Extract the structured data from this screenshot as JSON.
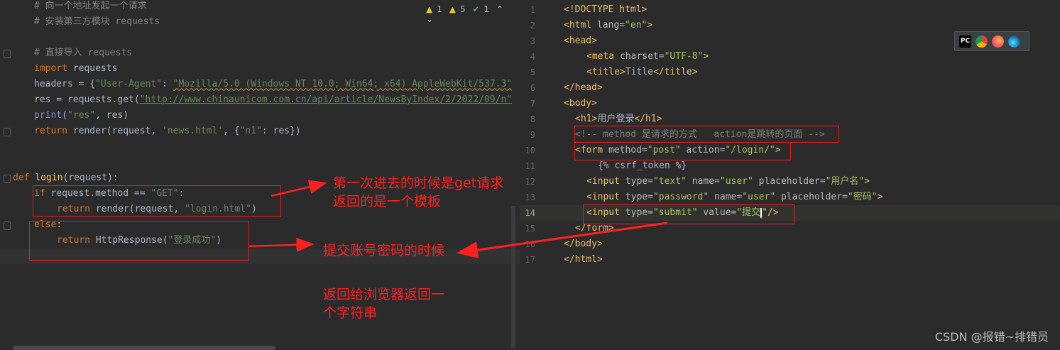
{
  "left_editor": {
    "inspections": {
      "warnings": "1",
      "weak_warnings": "5",
      "ok": "1"
    },
    "lines": {
      "l1": "# 向一个地址发起一个请求",
      "l2": "# 安装第三方模块 requests",
      "l4": "# 直接导入 requests",
      "l5_kw": "import",
      "l5_rest": " requests",
      "l6_a": "headers = {",
      "l6_key": "\"User-Agent\"",
      "l6_colon": ": ",
      "l6_val": "\"Mozilla/5.0 (Windows NT 10.0; Win64; x64) AppleWebKit/537.3\"",
      "l7_a": "res = requests.get(",
      "l7_url": "\"http://www.chinaunicom.com.cn/api/article/NewsByIndex/2/2022/09/n\"",
      "l8_fn": "print",
      "l8_a": "(",
      "l8_str": "\"res\"",
      "l8_b": ", res)",
      "l9_kw": "return",
      "l9_a": " render(request, ",
      "l9_s1": "'news.html'",
      "l9_b": ", {",
      "l9_s2": "\"n1\"",
      "l9_c": ": res})",
      "l12_kw": "def",
      "l12_fn": " login",
      "l12_a": "(request):",
      "l13_kw": "if",
      "l13_a": " request.method == ",
      "l13_str": "\"GET\"",
      "l13_b": ":",
      "l14_kw": "return",
      "l14_a": " render(request, ",
      "l14_str": "\"login.html\"",
      "l14_b": ")",
      "l15_kw": "else",
      "l15_b": ":",
      "l16_kw": "return",
      "l16_a": " HttpResponse(",
      "l16_str": "\"登录成功\"",
      "l16_b": ")"
    }
  },
  "right_editor": {
    "line_numbers": [
      "1",
      "2",
      "3",
      "4",
      "5",
      "6",
      "7",
      "8",
      "9",
      "10",
      "11",
      "12",
      "13",
      "14",
      "15",
      "16",
      "17"
    ],
    "lines": {
      "r1": "<!DOCTYPE html>",
      "r2_t": "<html ",
      "r2_a": "lang=",
      "r2_v": "\"en\"",
      "r2_e": ">",
      "r3": "<head>",
      "r4_t": "<meta ",
      "r4_a": "charset=",
      "r4_v": "\"UTF-8\"",
      "r4_e": ">",
      "r5_t": "<title>",
      "r5_x": "Title",
      "r5_e": "</title>",
      "r6": "</head>",
      "r7": "<body>",
      "r8_t": "<h1>",
      "r8_x": "用户登录",
      "r8_e": "</h1>",
      "r9": "<!-- method 是请求的方式   action是跳转的页面 -->",
      "r10_t": "<form ",
      "r10_a1": "method=",
      "r10_v1": "\"post\"",
      "r10_a2": " action=",
      "r10_v2": "\"/login/\"",
      "r10_e": ">",
      "r11": "{% csrf_token %}",
      "r12_t": "<input ",
      "r12_a1": "type=",
      "r12_v1": "\"text\"",
      "r12_a2": " name=",
      "r12_v2": "\"user\"",
      "r12_a3": " placeholder=",
      "r12_v3": "\"用户名\"",
      "r12_e": ">",
      "r13_t": "<input ",
      "r13_a1": "type=",
      "r13_v1": "\"password\"",
      "r13_a2": " name=",
      "r13_v2": "\"user\"",
      "r13_a3": " placeholder=",
      "r13_v3": "\"密码\"",
      "r13_e": ">",
      "r14_t": "<input ",
      "r14_a1": "type=",
      "r14_v1": "\"submit\"",
      "r14_a2": " value=",
      "r14_v2a": "\"提交",
      "r14_v2b": "\"",
      "r14_e": "/>",
      "r15": "</form>",
      "r16": "</body>",
      "r17": "</html>"
    }
  },
  "annotations": {
    "a1_l1": "第一次进去的时候是get请求",
    "a1_l2": "返回的是一个模板",
    "a2": "提交账号密码的时候",
    "a3_l1": "返回给浏览器返回一",
    "a3_l2": "个字符串"
  },
  "browser_icons": [
    "pycharm-icon",
    "chrome-icon",
    "firefox-icon",
    "edge-icon"
  ],
  "browser_icon_text": {
    "pycharm": "PC"
  },
  "watermark": "CSDN @报错~排错员",
  "colors": {
    "annotation": "#ff2020",
    "keyword": "#cc7832",
    "string": "#6a8759",
    "tag": "#e8bf6a"
  }
}
